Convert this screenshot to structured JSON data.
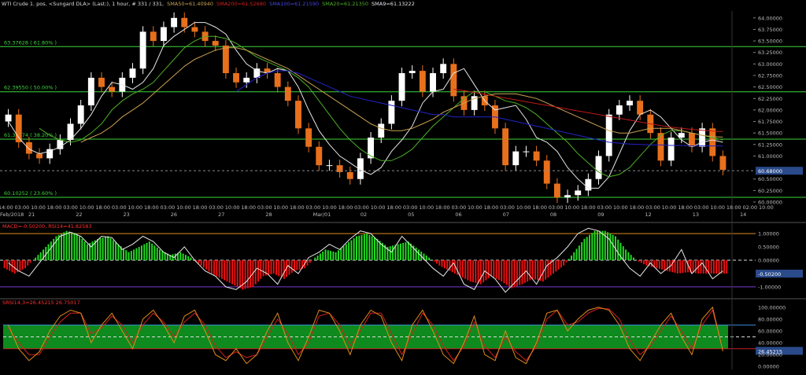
{
  "header": {
    "instrument": "WTI Crude 1. pos. <Sungard DLA> (Last:), 1 hour, # 331 / 331,",
    "sma50": "SMA50=61.40940",
    "sma200": "SMA200=61.52680",
    "sma100": "SMA100=61.21590",
    "sma20": "SMA20=61.21350",
    "sma9": "SMA9=61.13222"
  },
  "colors": {
    "background": "#000000",
    "up": "#ffffff",
    "down": "#e8701c",
    "sma9": "#e6e6e6",
    "sma20": "#4caf24",
    "sma50": "#c8a050",
    "sma100": "#2323c8",
    "sma200": "#c01818",
    "fib": "#3dd63d",
    "macd_pos": "#22dd22",
    "macd_neg": "#ee1111",
    "rsi": "#e8e8e8",
    "srsi_k": "#e08a1a",
    "srsi_d": "#d42020",
    "srsi_band": "#0e8a1e"
  },
  "chart_data": [
    {
      "type": "line",
      "panel": "price",
      "ylim": [
        60.0,
        64.15
      ],
      "y_ticks": [
        "64.00000",
        "63.75000",
        "63.50000",
        "63.25000",
        "63.00000",
        "62.75000",
        "62.50000",
        "62.25000",
        "62.00000",
        "61.75000",
        "61.50000",
        "61.25000",
        "61.00000",
        "60.75000",
        "60.50000",
        "60.25000",
        "60.00000"
      ],
      "last_price": "60.68000",
      "fib_levels": [
        {
          "value": 63.37628,
          "label": "63.37628 ( 61.80% )"
        },
        {
          "value": 62.3955,
          "label": "62.39550 ( 50.00% )"
        },
        {
          "value": 61.36574,
          "label": "61.36574 ( 38.20% )"
        },
        {
          "value": 60.10252,
          "label": "60.10252 ( 23.60% )"
        }
      ],
      "x_time_labels": [
        "14:00",
        "03:00",
        "10:00",
        "18:00",
        "03:00",
        "10:00",
        "18:00",
        "03:00",
        "10:00",
        "18:00",
        "03:00",
        "10:00",
        "18:00",
        "03:00",
        "10:00",
        "18:00",
        "03:00",
        "10:00",
        "18:00",
        "03:00",
        "10:00",
        "18:00",
        "03:00",
        "10:00",
        "18:00",
        "03:00",
        "10:00",
        "18:00",
        "03:00",
        "10:00",
        "18:00",
        "03:00",
        "10:00",
        "18:00",
        "03:00",
        "10:00",
        "18:00",
        "03:00",
        "10:00",
        "18:00",
        "03:00",
        "10:00",
        "18:00",
        "03:00",
        "10:00",
        "18:00",
        "02:00",
        "10:00"
      ],
      "x_date_labels": [
        "Feb/2018",
        "21",
        "22",
        "23",
        "26",
        "27",
        "28",
        "Mar/01",
        "02",
        "05",
        "06",
        "07",
        "08",
        "09",
        "12",
        "13",
        "14"
      ],
      "series": [
        {
          "name": "SMA9",
          "values": [
            61.75,
            61.4,
            61.15,
            61.05,
            61.1,
            61.2,
            61.35,
            61.6,
            61.9,
            62.3,
            62.6,
            62.55,
            62.45,
            62.6,
            62.9,
            63.4,
            63.6,
            63.75,
            63.9,
            63.9,
            63.8,
            63.65,
            63.3,
            63.0,
            62.85,
            62.8,
            62.9,
            62.85,
            62.5,
            62.0,
            61.55,
            61.25,
            61.0,
            60.85,
            60.7,
            60.6,
            60.75,
            61.1,
            61.35,
            61.65,
            62.15,
            62.4,
            62.45,
            62.8,
            62.9,
            62.55,
            62.2,
            62.0,
            62.05,
            62.1,
            61.8,
            61.4,
            61.3,
            61.1,
            60.75,
            60.5,
            60.3,
            60.3,
            60.55,
            61.05,
            61.55,
            61.9,
            62.0,
            61.85,
            61.6,
            61.35,
            61.2,
            61.3,
            61.35,
            61.3
          ]
        },
        {
          "name": "SMA20",
          "values": [
            null,
            null,
            null,
            61.6,
            61.45,
            61.35,
            61.3,
            61.35,
            61.5,
            61.7,
            62.0,
            62.2,
            62.35,
            62.45,
            62.6,
            62.85,
            63.1,
            63.35,
            63.5,
            63.6,
            63.6,
            63.55,
            63.45,
            63.3,
            63.15,
            63.05,
            62.95,
            62.85,
            62.7,
            62.5,
            62.2,
            61.9,
            61.6,
            61.35,
            61.15,
            61.0,
            60.9,
            60.9,
            61.0,
            61.15,
            61.4,
            61.65,
            61.85,
            62.05,
            62.25,
            62.4,
            62.4,
            62.3,
            62.2,
            62.15,
            62.05,
            61.9,
            61.7,
            61.5,
            61.3,
            61.05,
            60.85,
            60.65,
            60.55,
            60.6,
            60.75,
            61.0,
            61.25,
            61.45,
            61.55,
            61.55,
            61.5,
            61.45,
            61.4,
            61.35
          ]
        },
        {
          "name": "SMA50",
          "values": [
            null,
            null,
            null,
            null,
            null,
            null,
            null,
            61.3,
            61.4,
            61.5,
            61.65,
            61.85,
            62.0,
            62.15,
            62.35,
            62.55,
            62.75,
            62.95,
            63.1,
            63.2,
            63.3,
            63.35,
            63.35,
            63.3,
            63.2,
            63.1,
            63.0,
            62.9,
            62.75,
            62.6,
            62.45,
            62.3,
            62.15,
            62.0,
            61.85,
            61.7,
            61.6,
            61.55,
            61.55,
            61.6,
            61.7,
            61.8,
            61.95,
            62.05,
            62.15,
            62.25,
            62.3,
            62.35,
            62.35,
            62.35,
            62.3,
            62.25,
            62.15,
            62.05,
            61.95,
            61.85,
            61.75,
            61.65,
            61.55,
            61.5,
            61.5,
            61.55,
            61.6,
            61.6,
            61.6,
            61.55,
            61.5,
            61.45,
            61.42,
            61.41
          ]
        },
        {
          "name": "SMA100",
          "values": [
            null,
            null,
            null,
            null,
            null,
            null,
            null,
            null,
            null,
            null,
            null,
            null,
            null,
            null,
            null,
            null,
            null,
            null,
            null,
            null,
            null,
            null,
            62.4,
            62.55,
            62.7,
            62.8,
            62.85,
            62.85,
            62.8,
            62.7,
            62.6,
            62.5,
            62.4,
            62.3,
            62.25,
            62.2,
            62.15,
            62.1,
            62.05,
            62.0,
            61.95,
            61.9,
            61.9,
            61.85,
            61.85,
            61.85,
            61.85,
            61.85,
            61.8,
            61.75,
            61.7,
            61.65,
            61.6,
            61.55,
            61.5,
            61.45,
            61.4,
            61.35,
            61.3,
            61.28,
            61.26,
            61.25,
            61.24,
            61.24,
            61.23,
            61.23,
            61.22,
            61.22,
            61.22,
            61.22
          ]
        },
        {
          "name": "SMA200",
          "values": [
            null,
            null,
            null,
            null,
            null,
            null,
            null,
            null,
            null,
            null,
            null,
            null,
            null,
            null,
            null,
            null,
            null,
            null,
            null,
            null,
            null,
            null,
            null,
            null,
            null,
            null,
            null,
            null,
            null,
            null,
            null,
            null,
            null,
            null,
            null,
            null,
            null,
            null,
            null,
            null,
            null,
            null,
            null,
            62.45,
            62.42,
            62.38,
            62.34,
            62.3,
            62.26,
            62.22,
            62.18,
            62.14,
            62.1,
            62.06,
            62.02,
            61.98,
            61.94,
            61.9,
            61.86,
            61.82,
            61.78,
            61.74,
            61.7,
            61.66,
            61.63,
            61.6,
            61.58,
            61.56,
            61.54,
            61.53
          ]
        }
      ],
      "candle_closes": [
        61.9,
        61.3,
        61.05,
        60.95,
        61.15,
        61.35,
        61.7,
        62.1,
        62.7,
        62.5,
        62.4,
        62.7,
        62.9,
        63.7,
        63.5,
        63.8,
        64.0,
        63.8,
        63.7,
        63.5,
        63.4,
        62.8,
        62.6,
        62.7,
        62.9,
        62.8,
        62.5,
        62.2,
        61.6,
        61.2,
        60.8,
        60.8,
        60.65,
        60.5,
        60.95,
        61.4,
        61.7,
        62.2,
        62.8,
        62.85,
        62.4,
        62.8,
        63.0,
        62.3,
        62.0,
        62.3,
        62.1,
        61.6,
        60.8,
        61.1,
        61.1,
        60.9,
        60.4,
        60.1,
        60.15,
        60.25,
        60.5,
        61.0,
        61.9,
        62.1,
        62.2,
        61.9,
        61.5,
        60.9,
        61.4,
        61.5,
        61.2,
        61.6,
        61.0,
        60.7
      ]
    },
    {
      "type": "bar",
      "panel": "macd",
      "title": "MACD=-0.50200, RSI14=41.82583",
      "ylim": [
        -1.15,
        1.15
      ],
      "y_ticks": [
        "1.00000",
        "0.50000",
        "0.00000",
        "-0.50000",
        "-1.00000"
      ],
      "last_value": "-0.50200",
      "series": [
        {
          "name": "MACD",
          "values": [
            -0.3,
            -0.5,
            -0.3,
            0.1,
            0.5,
            0.9,
            1.1,
            1.0,
            0.6,
            0.8,
            0.9,
            0.6,
            0.3,
            0.5,
            0.7,
            0.4,
            0.2,
            0.3,
            0.1,
            -0.2,
            -0.5,
            -0.7,
            -0.9,
            -1.1,
            -1.0,
            -0.6,
            -0.5,
            -0.7,
            -0.4,
            -0.3,
            0.1,
            0.4,
            0.3,
            0.6,
            0.9,
            1.0,
            0.8,
            0.5,
            0.6,
            0.7,
            0.4,
            0.1,
            -0.2,
            -0.4,
            -0.6,
            -0.8,
            -0.9,
            -0.6,
            -0.8,
            -1.05,
            -0.9,
            -0.7,
            -0.8,
            -0.5,
            -0.2,
            0.3,
            0.8,
            1.1,
            1.1,
            0.9,
            0.4,
            0.0,
            -0.2,
            -0.3,
            -0.4,
            -0.5,
            -0.45,
            -0.5,
            -0.5,
            -0.5
          ]
        },
        {
          "name": "RSI14",
          "values": [
            -0.1,
            -0.4,
            -0.6,
            -0.1,
            0.4,
            0.9,
            1.05,
            0.9,
            0.5,
            0.9,
            0.85,
            0.4,
            0.6,
            0.9,
            0.7,
            0.3,
            0.1,
            0.5,
            0.0,
            -0.4,
            -0.6,
            -1.0,
            -1.1,
            -0.8,
            -0.3,
            -0.5,
            -0.9,
            -0.2,
            -0.5,
            0.1,
            0.3,
            0.6,
            0.4,
            0.8,
            1.1,
            1.0,
            0.6,
            0.3,
            0.9,
            0.5,
            0.1,
            -0.3,
            -0.6,
            -0.1,
            -0.9,
            -1.1,
            -0.4,
            -0.7,
            -1.2,
            -0.8,
            -0.4,
            -0.9,
            -0.2,
            0.1,
            0.5,
            1.0,
            1.2,
            1.1,
            0.8,
            0.2,
            -0.3,
            -0.6,
            -0.1,
            -0.5,
            -0.2,
            0.4,
            -0.5,
            -0.1,
            -0.7,
            -0.4
          ]
        }
      ]
    },
    {
      "type": "line",
      "panel": "srsi",
      "title": "SRSI14,3=26.45215 26.75017",
      "ylim": [
        -5,
        105
      ],
      "y_ticks": [
        "100.00000",
        "80.00000",
        "60.00000",
        "40.00000",
        "20.00000",
        "0.00000"
      ],
      "band": [
        30,
        70
      ],
      "last_value": "26.45215",
      "series": [
        {
          "name": "%K",
          "values": [
            70,
            30,
            10,
            25,
            60,
            85,
            95,
            90,
            40,
            70,
            90,
            60,
            30,
            80,
            95,
            70,
            40,
            85,
            95,
            60,
            20,
            10,
            30,
            5,
            20,
            60,
            90,
            40,
            10,
            50,
            95,
            90,
            60,
            20,
            70,
            95,
            85,
            40,
            10,
            70,
            95,
            60,
            20,
            5,
            40,
            85,
            20,
            10,
            60,
            15,
            5,
            40,
            90,
            95,
            60,
            80,
            95,
            100,
            95,
            70,
            30,
            10,
            40,
            70,
            90,
            50,
            20,
            80,
            100,
            26
          ]
        },
        {
          "name": "%D",
          "values": [
            65,
            40,
            20,
            20,
            50,
            75,
            90,
            90,
            55,
            65,
            85,
            70,
            40,
            70,
            90,
            75,
            50,
            75,
            90,
            70,
            35,
            15,
            25,
            15,
            20,
            50,
            80,
            55,
            20,
            40,
            85,
            90,
            70,
            35,
            60,
            90,
            90,
            55,
            20,
            55,
            90,
            70,
            35,
            10,
            35,
            75,
            35,
            15,
            50,
            25,
            10,
            35,
            80,
            95,
            70,
            75,
            90,
            98,
            97,
            80,
            45,
            20,
            35,
            60,
            85,
            60,
            30,
            70,
            95,
            27
          ]
        }
      ]
    }
  ]
}
